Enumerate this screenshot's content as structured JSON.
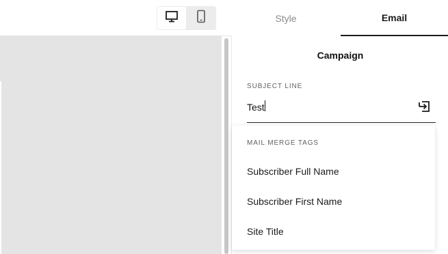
{
  "tabs": [
    {
      "label": "Style",
      "active": false
    },
    {
      "label": "Email",
      "active": true
    }
  ],
  "device_toggle": {
    "options": [
      {
        "icon": "desktop-icon",
        "active": true
      },
      {
        "icon": "mobile-icon",
        "active": false
      }
    ]
  },
  "panel": {
    "title": "Campaign",
    "subject_line": {
      "label": "SUBJECT LINE",
      "value": "Test",
      "action_icon": "insert-tag-icon"
    }
  },
  "merge_tags": {
    "header": "MAIL MERGE TAGS",
    "items": [
      "Subscriber Full Name",
      "Subscriber First Name",
      "Site Title"
    ]
  },
  "colors": {
    "accent": "#1a1a1a",
    "muted_text": "#8a8a8a",
    "preview_bg": "#e4e4e4"
  }
}
